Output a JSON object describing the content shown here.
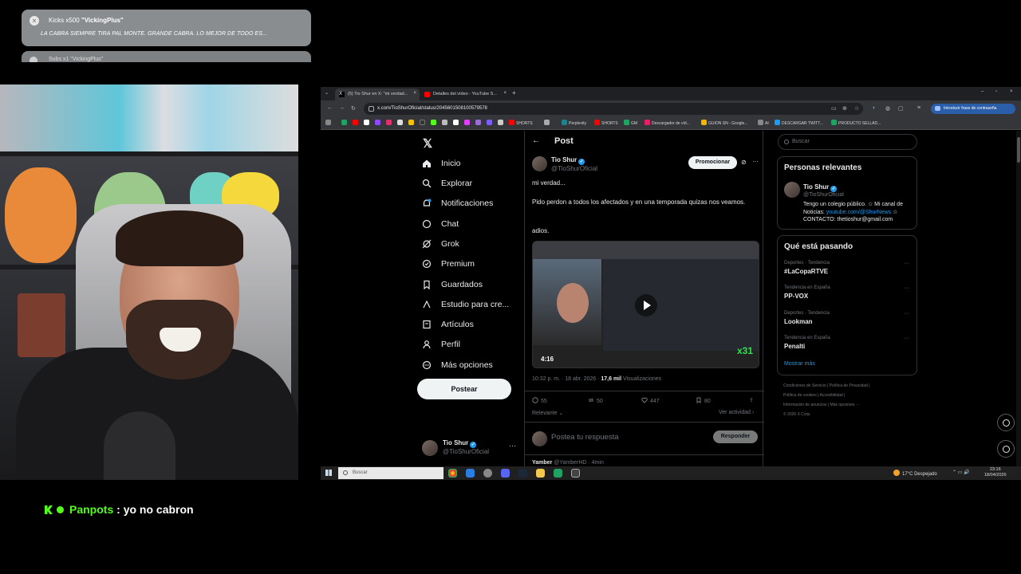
{
  "alerts": [
    {
      "prefix": "Kicks x500 ",
      "user": "\"VickingPlus\"",
      "message": "LA CABRA SIEMPRE TIRA PAL MONTE. GRANDE CABRA. LO MEJOR DE TODO ES..."
    },
    {
      "partial_title": "Subs x1 \"VickingPlus\""
    }
  ],
  "browser": {
    "tabs": [
      {
        "label": "(5) Tio Shur en X: \"mi verdad...",
        "active": true
      },
      {
        "label": "Detalles del vídeo - YouTube S...",
        "active": false
      }
    ],
    "url": "x.com/TioShurOficial/status/2045601508100579578",
    "password_button": "Introducir frase de contraseña",
    "bookmarks": [
      "SHORTS",
      "Perplexity",
      "SHORTS",
      "GM",
      "Descargador de víd...",
      "GUION SN - Google...",
      "AI",
      "DESCARGAR TWITT...",
      "PRODUCTO SELLAD..."
    ]
  },
  "x_nav": {
    "items": [
      {
        "label": "Inicio",
        "icon": "home-icon"
      },
      {
        "label": "Explorar",
        "icon": "search-icon"
      },
      {
        "label": "Notificaciones",
        "icon": "bell-icon"
      },
      {
        "label": "Chat",
        "icon": "chat-icon"
      },
      {
        "label": "Grok",
        "icon": "grok-icon"
      },
      {
        "label": "Premium",
        "icon": "premium-icon"
      },
      {
        "label": "Guardados",
        "icon": "bookmark-icon"
      },
      {
        "label": "Estudio para cre...",
        "icon": "studio-icon"
      },
      {
        "label": "Artículos",
        "icon": "articles-icon"
      },
      {
        "label": "Perfil",
        "icon": "profile-icon"
      },
      {
        "label": "Más opciones",
        "icon": "more-icon"
      }
    ],
    "post_button": "Postear",
    "me": {
      "name": "Tio Shur",
      "handle": "@TioShurOficial"
    }
  },
  "post": {
    "header": "Post",
    "author": {
      "name": "Tio Shur",
      "handle": "@TioShurOficial"
    },
    "promote": "Promocionar",
    "text_lines": [
      "mi verdad...",
      "Pido perdon a todos los afectados y en una temporada quizas nos veamos.",
      "adios."
    ],
    "duration": "4:16",
    "overlay_badge": "x31",
    "time": "10:32 p. m. · 18 abr. 2026 · ",
    "views_count": "17,6 mil",
    "views_label": " Visualizaciones",
    "stats": {
      "replies": "55",
      "reposts": "50",
      "likes": "447",
      "bookmarks": "80"
    },
    "sort_label": "Relevante",
    "activity_label": "Ver actividad",
    "reply_placeholder": "Postea tu respuesta",
    "reply_button": "Responder",
    "next_reply": {
      "name": "Yamber",
      "handle": "@YamberHD · 4min"
    }
  },
  "sidebar": {
    "search_placeholder": "Buscar",
    "relevant": {
      "title": "Personas relevantes",
      "name": "Tio Shur",
      "handle": "@TioShurOficial",
      "bio_a": "Tengo un colegio público. ☆ Mi canal de Noticias: ",
      "bio_link": "youtube.com/@ShurNews",
      "bio_b": " ☆ CONTACTO: thetioshur@gmail.com"
    },
    "trends": {
      "title": "Qué está pasando",
      "items": [
        {
          "context": "Deportes · Tendencia",
          "name": "#LaCopaRTVE"
        },
        {
          "context": "Tendencia en España",
          "name": "PP-VOX"
        },
        {
          "context": "Deportes · Tendencia",
          "name": "Lookman"
        },
        {
          "context": "Tendencia en España",
          "name": "Penalti"
        }
      ],
      "show_more": "Mostrar más"
    },
    "footer": [
      "Condiciones de Servicio | Política de Privacidad |",
      "Política de cookies | Accesibilidad |",
      "Información de anuncios | Más opciones ···",
      "© 2026 X Corp."
    ]
  },
  "taskbar": {
    "search": "Buscar",
    "weather": "17°C  Despejado",
    "time": "23:16",
    "date": "18/04/2026"
  },
  "chat": {
    "user": "Panpots",
    "separator": " : ",
    "text": "yo no cabron"
  }
}
